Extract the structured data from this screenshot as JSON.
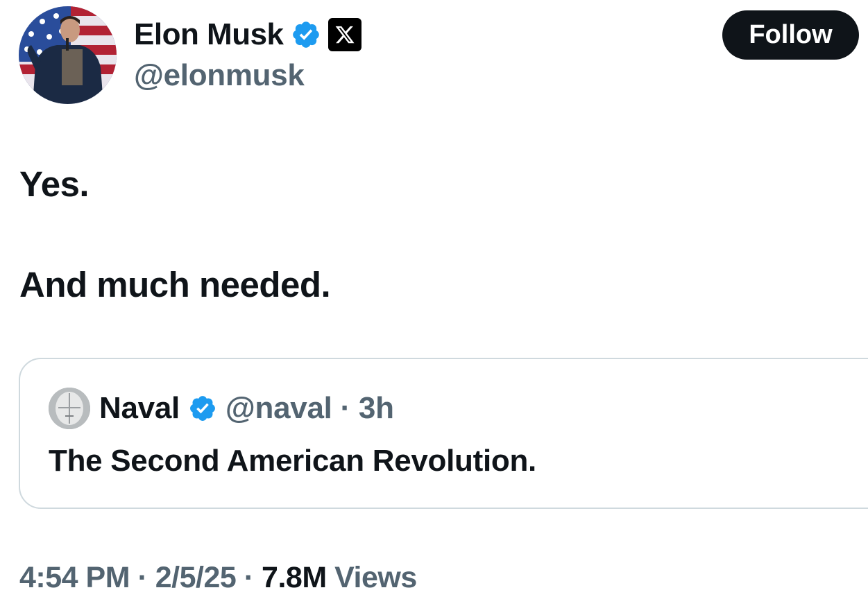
{
  "author": {
    "name": "Elon Musk",
    "handle": "@elonmusk",
    "avatar_icon": "person-avatar-flag-background",
    "verified_icon": "verified-badge-icon",
    "affiliation_icon": "x-logo-icon"
  },
  "follow_button": {
    "label": "Follow"
  },
  "tweet": {
    "lines": [
      "Yes.",
      "And much needed."
    ]
  },
  "quote": {
    "name": "Naval",
    "handle": "@naval",
    "separator": "·",
    "time": "3h",
    "text": "The Second American Revolution.",
    "avatar_icon": "robot-head-avatar",
    "verified_icon": "verified-badge-icon"
  },
  "meta": {
    "time": "4:54 PM",
    "date": "2/5/25",
    "separator": "·",
    "views_count": "7.8M",
    "views_label": "Views"
  },
  "colors": {
    "text_primary": "#0f1419",
    "text_secondary": "#536471",
    "verified_blue": "#1d9bf0",
    "border": "#cfd9de"
  }
}
